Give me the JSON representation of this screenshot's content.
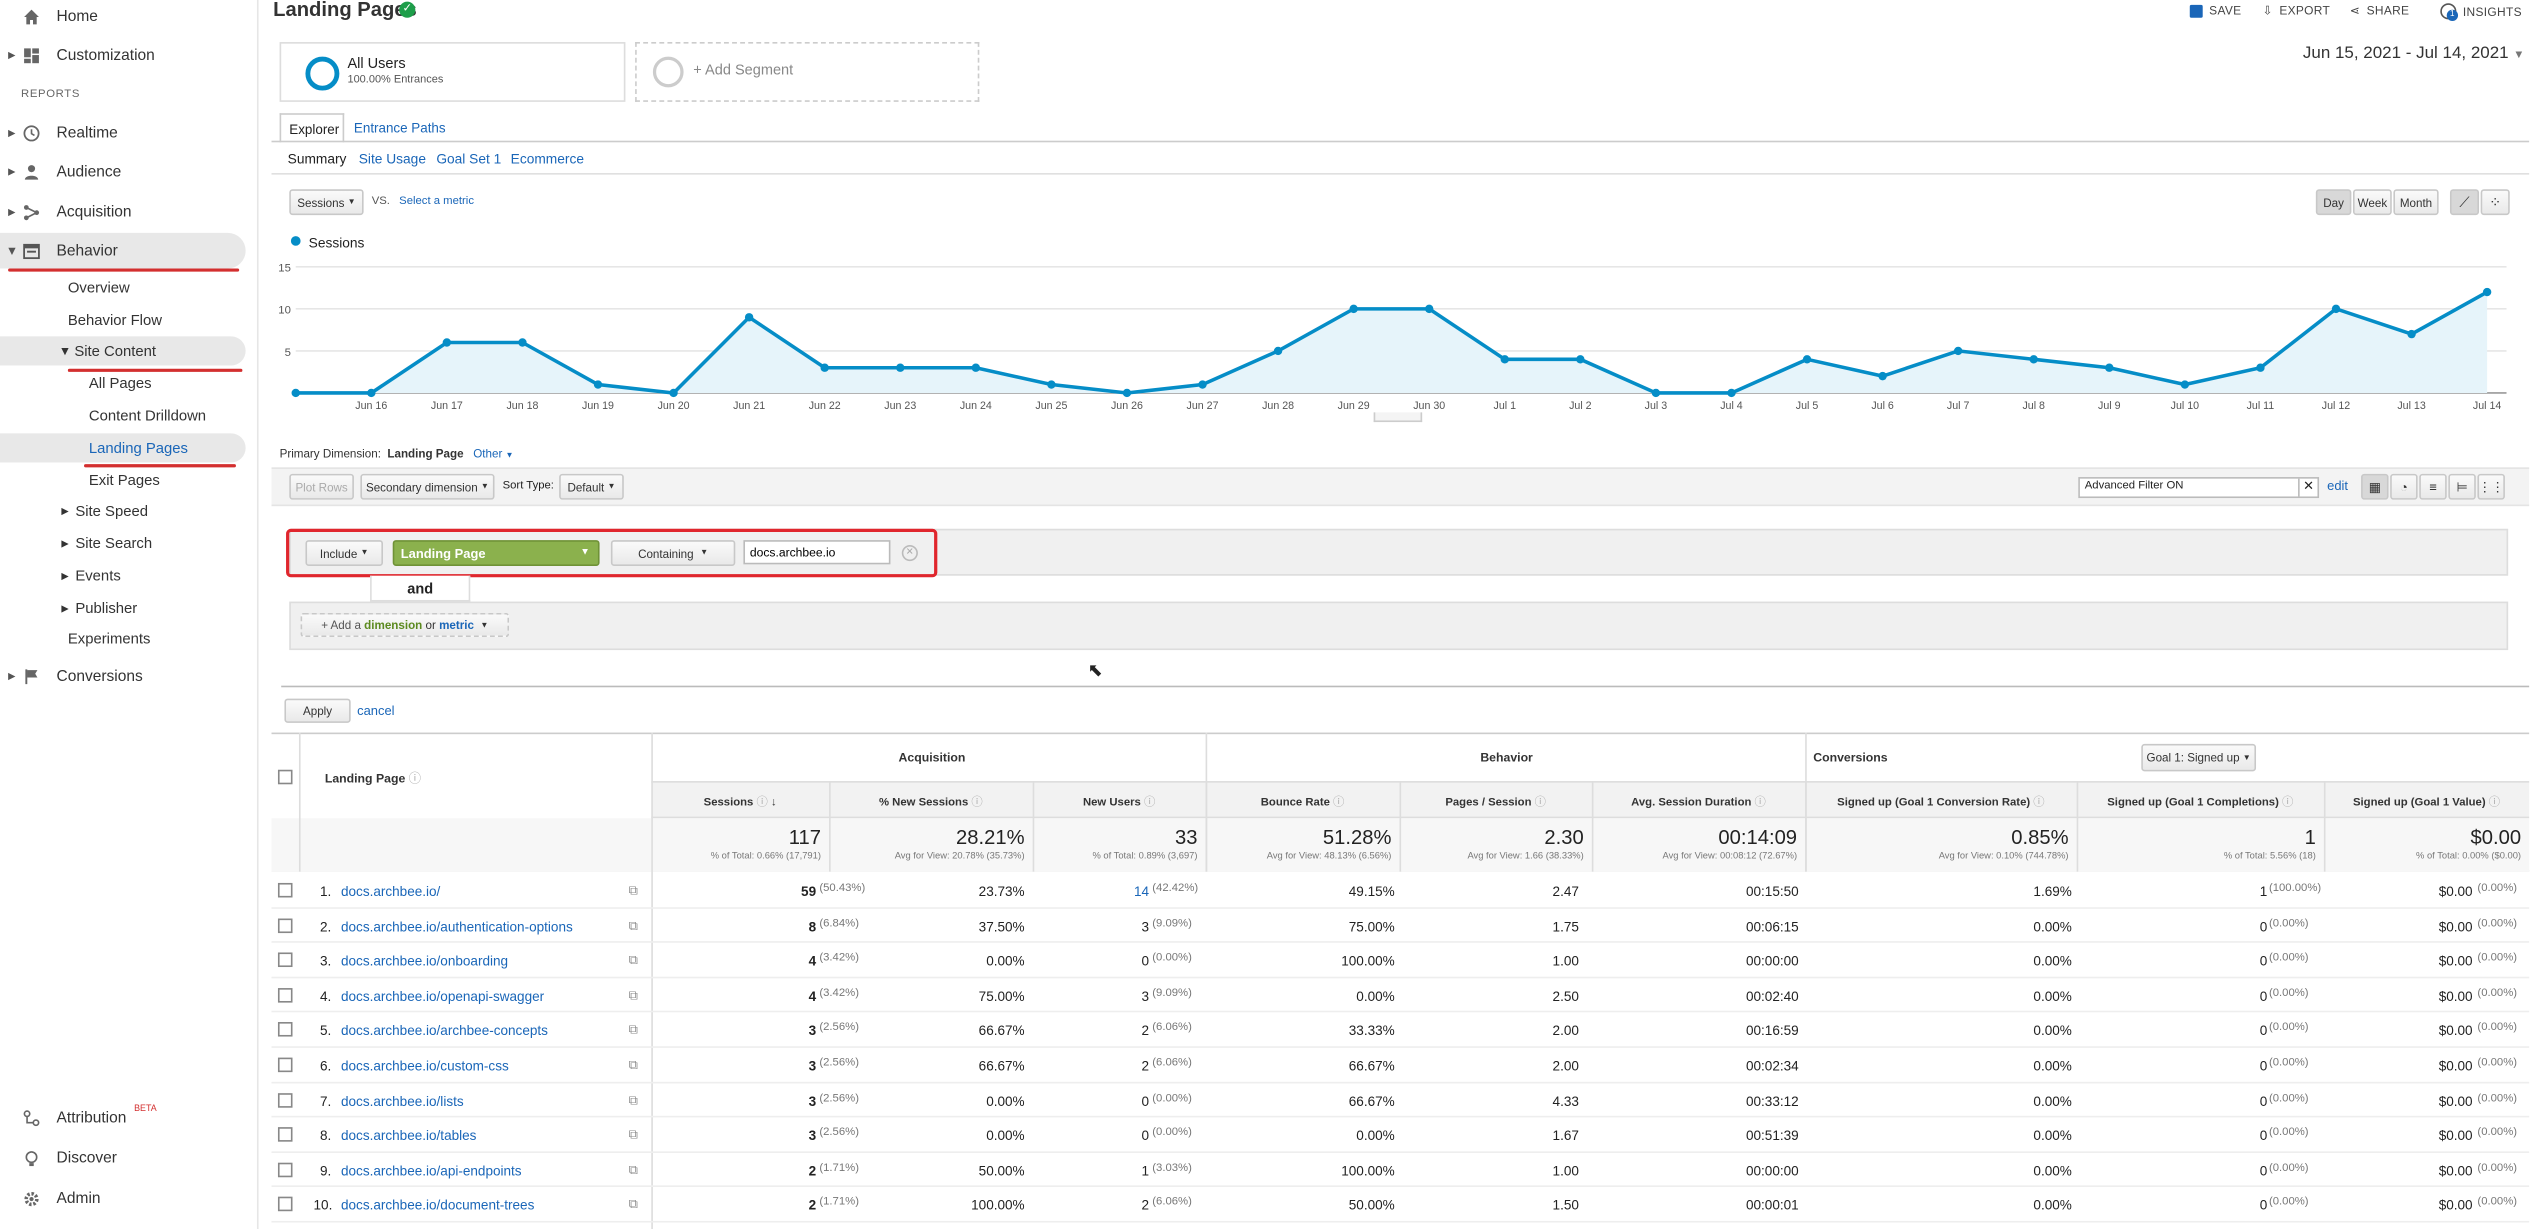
{
  "sidebar": {
    "top": [
      {
        "label": "Home",
        "icon": "home-icon"
      },
      {
        "label": "Customization",
        "icon": "dashboard-icon"
      }
    ],
    "section": "REPORTS",
    "reports": [
      {
        "label": "Realtime",
        "icon": "clock-icon"
      },
      {
        "label": "Audience",
        "icon": "person-icon"
      },
      {
        "label": "Acquisition",
        "icon": "acquisition-icon"
      },
      {
        "label": "Behavior",
        "icon": "behavior-icon"
      }
    ],
    "behavior_items": [
      "Overview",
      "Behavior Flow",
      "Site Content"
    ],
    "site_content_items": [
      "All Pages",
      "Content Drilldown",
      "Landing Pages",
      "Exit Pages"
    ],
    "behavior_more": [
      "Site Speed",
      "Site Search",
      "Events",
      "Publisher",
      "Experiments"
    ],
    "conversions": "Conversions",
    "bottom": [
      {
        "label": "Attribution",
        "badge": "BETA"
      },
      {
        "label": "Discover"
      },
      {
        "label": "Admin"
      }
    ]
  },
  "header": {
    "title": "Landing Pages",
    "save": "SAVE",
    "export": "EXPORT",
    "share": "SHARE",
    "insights": "INSIGHTS",
    "insights_badge": "1"
  },
  "segments": {
    "all_users": "All Users",
    "all_users_sub": "100.00% Entrances",
    "add": "+ Add Segment"
  },
  "date_range": "Jun 15, 2021 - Jul 14, 2021",
  "tabs": {
    "explorer": "Explorer",
    "entrance_paths": "Entrance Paths"
  },
  "subtabs": [
    "Summary",
    "Site Usage",
    "Goal Set 1",
    "Ecommerce"
  ],
  "metric_controls": {
    "metric": "Sessions",
    "vs": "VS.",
    "select_metric": "Select a metric",
    "day": "Day",
    "week": "Week",
    "month": "Month"
  },
  "chart_data": {
    "type": "line",
    "series": [
      {
        "name": "Sessions",
        "values": [
          0,
          0,
          6,
          6,
          1,
          0,
          9,
          3,
          3,
          3,
          1,
          0,
          1,
          5,
          10,
          10,
          4,
          4,
          0,
          0,
          4,
          2,
          5,
          4,
          3,
          1,
          3,
          10,
          7,
          12
        ]
      }
    ],
    "x": [
      "Jun 15",
      "Jun 16",
      "Jun 17",
      "Jun 18",
      "Jun 19",
      "Jun 20",
      "Jun 21",
      "Jun 22",
      "Jun 23",
      "Jun 24",
      "Jun 25",
      "Jun 26",
      "Jun 27",
      "Jun 28",
      "Jun 29",
      "Jun 30",
      "Jul 1",
      "Jul 2",
      "Jul 3",
      "Jul 4",
      "Jul 5",
      "Jul 6",
      "Jul 7",
      "Jul 8",
      "Jul 9",
      "Jul 10",
      "Jul 11",
      "Jul 12",
      "Jul 13",
      "Jul 14"
    ],
    "x_tick_labels": [
      "Jun 16",
      "Jun 17",
      "Jun 18",
      "Jun 19",
      "Jun 20",
      "Jun 21",
      "Jun 22",
      "Jun 23",
      "Jun 24",
      "Jun 25",
      "Jun 26",
      "Jun 27",
      "Jun 28",
      "Jun 29",
      "Jun 30",
      "Jul 1",
      "Jul 2",
      "Jul 3",
      "Jul 4",
      "Jul 5",
      "Jul 6",
      "Jul 7",
      "Jul 8",
      "Jul 9",
      "Jul 10",
      "Jul 11",
      "Jul 12",
      "Jul 13",
      "Jul 14"
    ],
    "y_ticks": [
      5,
      10,
      15
    ],
    "ylim": [
      0,
      15
    ],
    "grid": true,
    "legend": "top-left",
    "color": "#058dc7",
    "fill": "#e6f4fa"
  },
  "primary_dimension": {
    "label": "Primary Dimension:",
    "value": "Landing Page",
    "other": "Other"
  },
  "toolbar": {
    "plot_rows": "Plot Rows",
    "secondary": "Secondary dimension",
    "sort_type_label": "Sort Type:",
    "sort_type": "Default",
    "filter": "Advanced Filter ON",
    "edit": "edit"
  },
  "filter": {
    "include": "Include",
    "dimension": "Landing Page",
    "match": "Containing",
    "value": "docs.archbee.io",
    "and": "and",
    "add_prefix": "+ Add a",
    "add_dimension": "dimension",
    "add_or": "or",
    "add_metric": "metric",
    "apply": "Apply",
    "cancel": "cancel"
  },
  "table": {
    "groups": {
      "acquisition": "Acquisition",
      "behavior": "Behavior",
      "conversions": "Conversions",
      "goal_select": "Goal 1: Signed up"
    },
    "first_header": "Landing Page",
    "columns": [
      "Sessions",
      "% New Sessions",
      "New Users",
      "Bounce Rate",
      "Pages / Session",
      "Avg. Session Duration",
      "Signed up (Goal 1 Conversion Rate)",
      "Signed up (Goal 1 Completions)",
      "Signed up (Goal 1 Value)"
    ],
    "totals": [
      {
        "v": "117",
        "s": "% of Total: 0.66% (17,791)"
      },
      {
        "v": "28.21%",
        "s": "Avg for View: 20.78% (35.73%)"
      },
      {
        "v": "33",
        "s": "% of Total: 0.89% (3,697)"
      },
      {
        "v": "51.28%",
        "s": "Avg for View: 48.13% (6.56%)"
      },
      {
        "v": "2.30",
        "s": "Avg for View: 1.66 (38.33%)"
      },
      {
        "v": "00:14:09",
        "s": "Avg for View: 00:08:12 (72.67%)"
      },
      {
        "v": "0.85%",
        "s": "Avg for View: 0.10% (744.78%)"
      },
      {
        "v": "1",
        "s": "% of Total: 5.56% (18)"
      },
      {
        "v": "$0.00",
        "s": "% of Total: 0.00% ($0.00)"
      }
    ],
    "rows": [
      {
        "n": "1.",
        "page": "docs.archbee.io/",
        "s": "59",
        "sp": "(50.43%)",
        "ns": "23.73%",
        "nu": "14",
        "nup": "(42.42%)",
        "br": "49.15%",
        "ps": "2.47",
        "dur": "00:15:50",
        "cr": "1.69%",
        "c": "1",
        "cp": "(100.00%)",
        "val": "$0.00",
        "vp": "(0.00%)"
      },
      {
        "n": "2.",
        "page": "docs.archbee.io/authentication-options",
        "s": "8",
        "sp": "(6.84%)",
        "ns": "37.50%",
        "nu": "3",
        "nup": "(9.09%)",
        "br": "75.00%",
        "ps": "1.75",
        "dur": "00:06:15",
        "cr": "0.00%",
        "c": "0",
        "cp": "(0.00%)",
        "val": "$0.00",
        "vp": "(0.00%)"
      },
      {
        "n": "3.",
        "page": "docs.archbee.io/onboarding",
        "s": "4",
        "sp": "(3.42%)",
        "ns": "0.00%",
        "nu": "0",
        "nup": "(0.00%)",
        "br": "100.00%",
        "ps": "1.00",
        "dur": "00:00:00",
        "cr": "0.00%",
        "c": "0",
        "cp": "(0.00%)",
        "val": "$0.00",
        "vp": "(0.00%)"
      },
      {
        "n": "4.",
        "page": "docs.archbee.io/openapi-swagger",
        "s": "4",
        "sp": "(3.42%)",
        "ns": "75.00%",
        "nu": "3",
        "nup": "(9.09%)",
        "br": "0.00%",
        "ps": "2.50",
        "dur": "00:02:40",
        "cr": "0.00%",
        "c": "0",
        "cp": "(0.00%)",
        "val": "$0.00",
        "vp": "(0.00%)"
      },
      {
        "n": "5.",
        "page": "docs.archbee.io/archbee-concepts",
        "s": "3",
        "sp": "(2.56%)",
        "ns": "66.67%",
        "nu": "2",
        "nup": "(6.06%)",
        "br": "33.33%",
        "ps": "2.00",
        "dur": "00:16:59",
        "cr": "0.00%",
        "c": "0",
        "cp": "(0.00%)",
        "val": "$0.00",
        "vp": "(0.00%)"
      },
      {
        "n": "6.",
        "page": "docs.archbee.io/custom-css",
        "s": "3",
        "sp": "(2.56%)",
        "ns": "66.67%",
        "nu": "2",
        "nup": "(6.06%)",
        "br": "66.67%",
        "ps": "2.00",
        "dur": "00:02:34",
        "cr": "0.00%",
        "c": "0",
        "cp": "(0.00%)",
        "val": "$0.00",
        "vp": "(0.00%)"
      },
      {
        "n": "7.",
        "page": "docs.archbee.io/lists",
        "s": "3",
        "sp": "(2.56%)",
        "ns": "0.00%",
        "nu": "0",
        "nup": "(0.00%)",
        "br": "66.67%",
        "ps": "4.33",
        "dur": "00:33:12",
        "cr": "0.00%",
        "c": "0",
        "cp": "(0.00%)",
        "val": "$0.00",
        "vp": "(0.00%)"
      },
      {
        "n": "8.",
        "page": "docs.archbee.io/tables",
        "s": "3",
        "sp": "(2.56%)",
        "ns": "0.00%",
        "nu": "0",
        "nup": "(0.00%)",
        "br": "0.00%",
        "ps": "1.67",
        "dur": "00:51:39",
        "cr": "0.00%",
        "c": "0",
        "cp": "(0.00%)",
        "val": "$0.00",
        "vp": "(0.00%)"
      },
      {
        "n": "9.",
        "page": "docs.archbee.io/api-endpoints",
        "s": "2",
        "sp": "(1.71%)",
        "ns": "50.00%",
        "nu": "1",
        "nup": "(3.03%)",
        "br": "100.00%",
        "ps": "1.00",
        "dur": "00:00:00",
        "cr": "0.00%",
        "c": "0",
        "cp": "(0.00%)",
        "val": "$0.00",
        "vp": "(0.00%)"
      },
      {
        "n": "10.",
        "page": "docs.archbee.io/document-trees",
        "s": "2",
        "sp": "(1.71%)",
        "ns": "100.00%",
        "nu": "2",
        "nup": "(6.06%)",
        "br": "50.00%",
        "ps": "1.50",
        "dur": "00:00:01",
        "cr": "0.00%",
        "c": "0",
        "cp": "(0.00%)",
        "val": "$0.00",
        "vp": "(0.00%)"
      }
    ]
  }
}
